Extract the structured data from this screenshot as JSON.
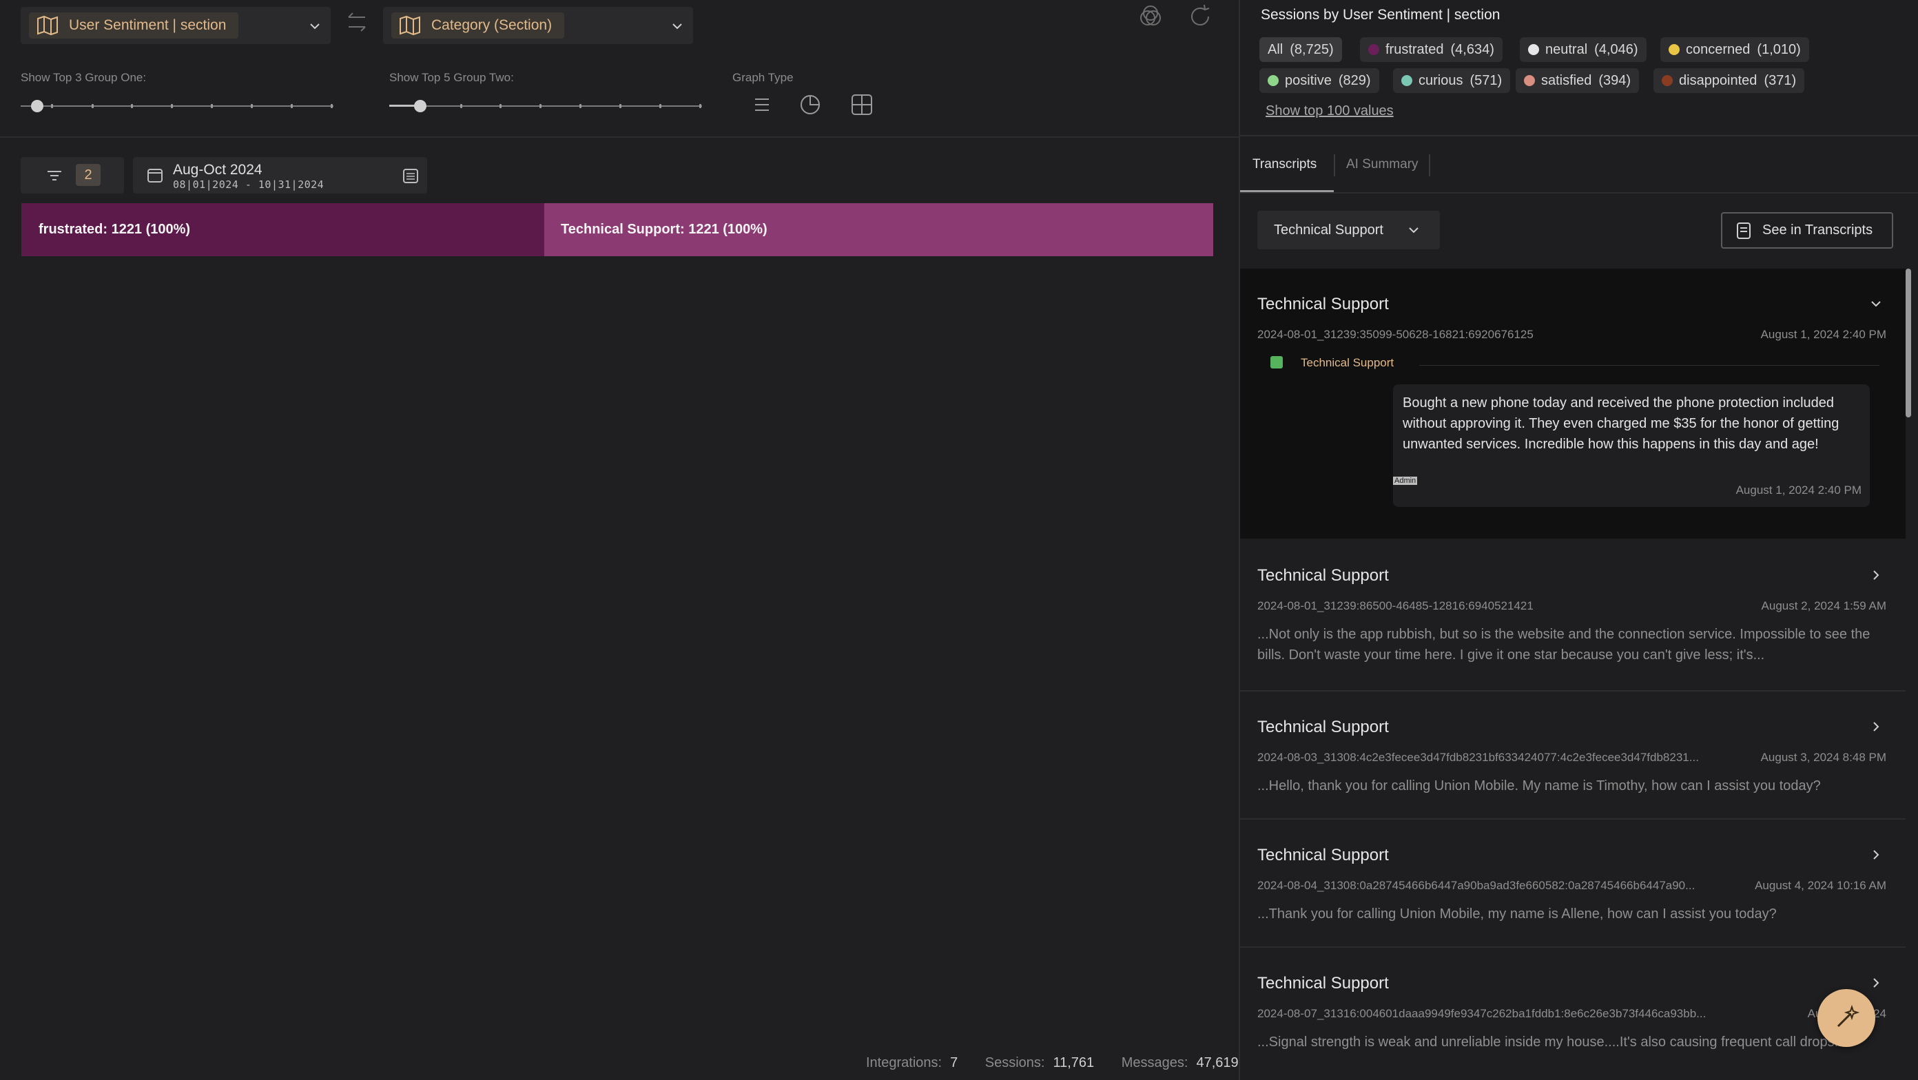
{
  "selectors": {
    "group_one": "User Sentiment | section",
    "group_two": "Category (Section)"
  },
  "sliders": {
    "group_one_label": "Show Top 3 Group One:",
    "group_one_value": 3,
    "group_two_label": "Show Top 5 Group Two:",
    "group_two_value": 5,
    "graph_type_label": "Graph Type"
  },
  "filters": {
    "count": "2",
    "date_title": "Aug-Oct 2024",
    "date_range": "08|01|2024 - 10|31|2024"
  },
  "chart_data": {
    "type": "bar",
    "orientation": "horizontal-stacked",
    "segments": [
      {
        "label": "frustrated: 1221 (100%)",
        "group": "frustrated",
        "value": 1221,
        "percent": 100,
        "color": "#5c1a4a"
      },
      {
        "label": "Technical Support: 1221 (100%)",
        "group": "Technical Support",
        "value": 1221,
        "percent": 100,
        "color": "#8c3a72"
      }
    ]
  },
  "footer": {
    "integrations_label": "Integrations:",
    "integrations_value": "7",
    "sessions_label": "Sessions:",
    "sessions_value": "11,761",
    "messages_label": "Messages:",
    "messages_value": "47,619"
  },
  "panel": {
    "title": "Sessions by User Sentiment | section",
    "pills": [
      {
        "label": "All",
        "count": "(8,725)",
        "color": ""
      },
      {
        "label": "frustrated",
        "count": "(4,634)",
        "color": "#6b1f59"
      },
      {
        "label": "neutral",
        "count": "(4,046)",
        "color": "#e6e6e6"
      },
      {
        "label": "concerned",
        "count": "(1,010)",
        "color": "#e8c545"
      },
      {
        "label": "positive",
        "count": "(829)",
        "color": "#8ed68a"
      },
      {
        "label": "curious",
        "count": "(571)",
        "color": "#7cc6b4"
      },
      {
        "label": "satisfied",
        "count": "(394)",
        "color": "#d98f80"
      },
      {
        "label": "disappointed",
        "count": "(371)",
        "color": "#8a3c22"
      }
    ],
    "show_top": "Show top 100 values",
    "tabs": [
      "Transcripts",
      "AI Summary"
    ],
    "topic_select": "Technical Support",
    "see_button": "See in Transcripts"
  },
  "transcripts": [
    {
      "title": "Technical Support",
      "id": "2024-08-01_31239:35099-50628-16821:6920676125",
      "date": "August 1, 2024 2:40 PM",
      "msg_label": "Technical Support",
      "msg_text": "Bought a new phone today and received the phone protection included without approving it. They even charged me $35 for the honor of getting unwanted services. Incredible how this happens in this day and age!",
      "msg_role": "Admin",
      "msg_date": "August 1, 2024 2:40 PM"
    },
    {
      "title": "Technical Support",
      "id": "2024-08-01_31239:86500-46485-12816:6940521421",
      "date": "August 2, 2024 1:59 AM",
      "snippet": "...Not only is the app rubbish, but so is the website and the connection service. Impossible to see the bills. Don't waste your time here. I give it one star because you can't give less; it's..."
    },
    {
      "title": "Technical Support",
      "id": "2024-08-03_31308:4c2e3fecee3d47fdb8231bf633424077:4c2e3fecee3d47fdb8231...",
      "date": "August 3, 2024 8:48 PM",
      "snippet": "...Hello, thank you for calling Union Mobile. My name is Timothy, how can I assist you today?"
    },
    {
      "title": "Technical Support",
      "id": "2024-08-04_31308:0a28745466b6447a90ba9ad3fe660582:0a28745466b6447a90...",
      "date": "August 4, 2024 10:16 AM",
      "snippet": "...Thank you for calling Union Mobile, my name is Allene, how can I assist you today?"
    },
    {
      "title": "Technical Support",
      "id": "2024-08-07_31316:004601daaa9949fe9347c262ba1fddb1:8e6c26e3b73f446ca93bb...",
      "date": "August 7, 2024",
      "snippet": "...Signal strength is weak and unreliable inside my house....It's also causing frequent call drops."
    }
  ]
}
